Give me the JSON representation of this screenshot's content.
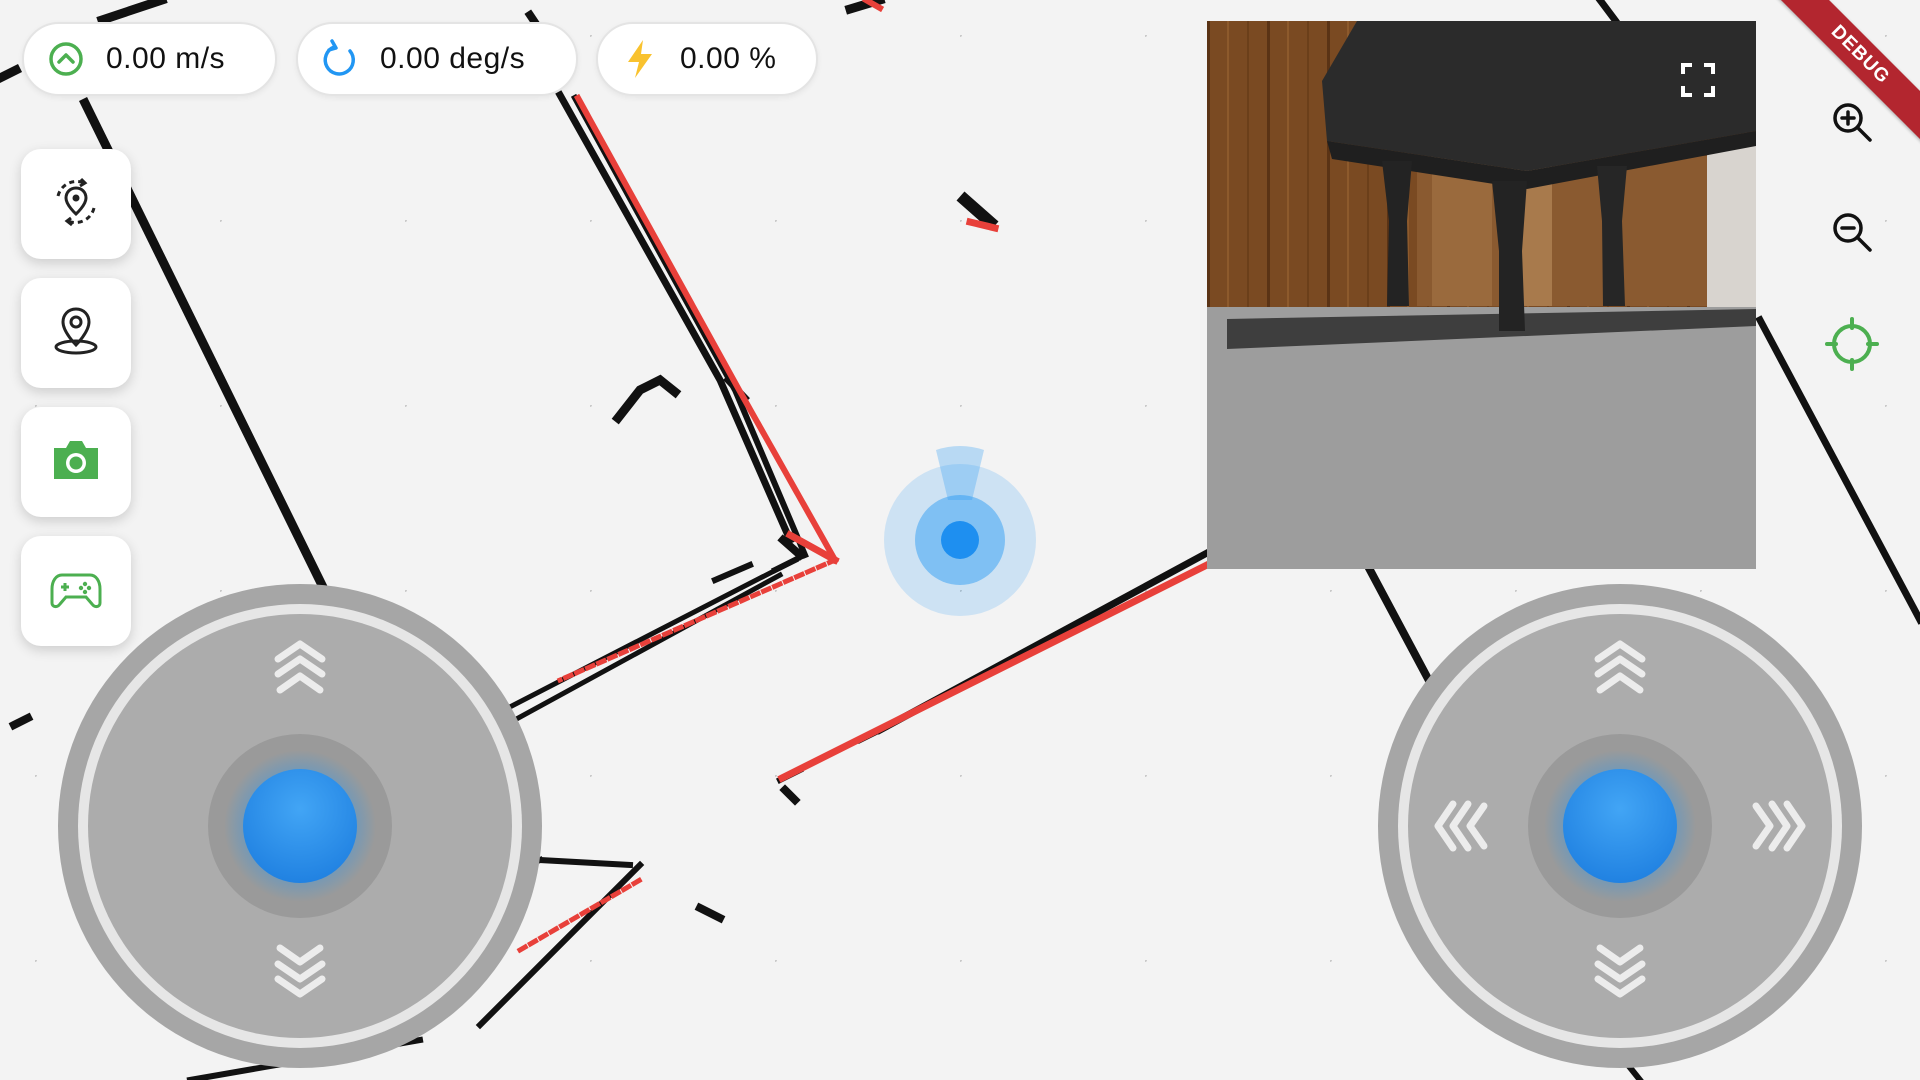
{
  "status": {
    "linear_speed": "0.00 m/s",
    "angular_speed": "0.00 deg/s",
    "battery": "0.00 %"
  },
  "icons": {
    "linear": "up-arrow-circle-icon",
    "angular": "rotate-icon",
    "battery": "lightning-icon",
    "relocalize": "relocalize-pin-icon",
    "navigate": "location-pin-icon",
    "camera": "camera-icon",
    "gamepad": "gamepad-icon",
    "fullscreen": "fullscreen-icon",
    "zoom_in": "zoom-in-icon",
    "zoom_out": "zoom-out-icon",
    "locate": "crosshair-icon"
  },
  "debug_label": "DEBUG",
  "colors": {
    "accent_green": "#4caf50",
    "accent_blue": "#2196f3",
    "battery_yellow": "#f9c22e",
    "laser_red": "#e8403a",
    "debug_red": "#b3262f"
  }
}
